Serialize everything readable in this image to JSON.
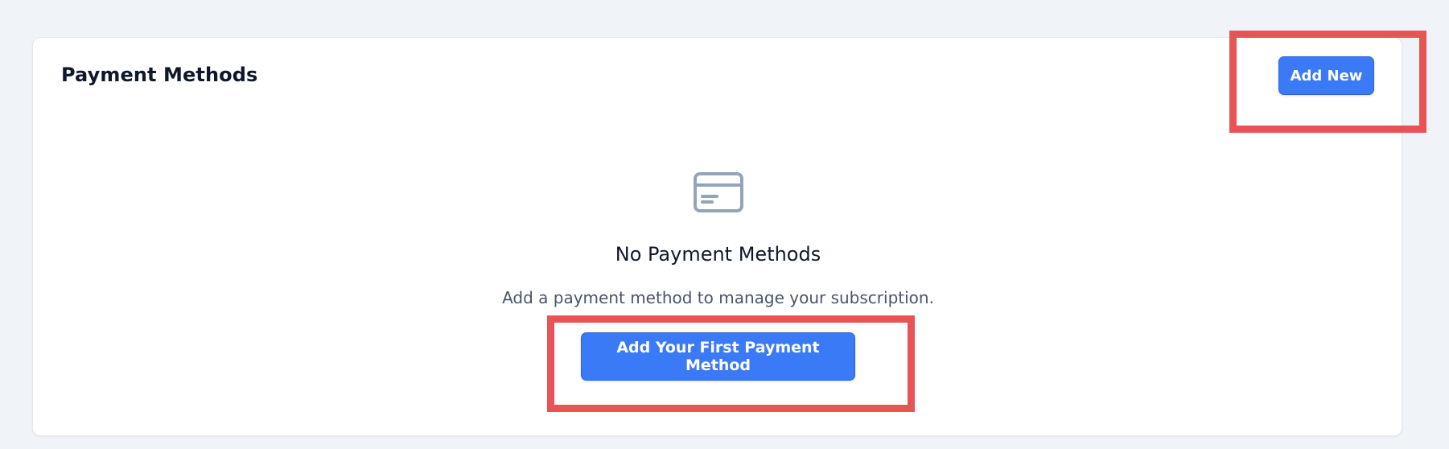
{
  "card": {
    "title": "Payment Methods",
    "add_new_label": "Add New"
  },
  "empty_state": {
    "icon": "credit-card-icon",
    "title": "No Payment Methods",
    "description": "Add a payment method to manage your subscription.",
    "cta_label": "Add Your First Payment Method"
  },
  "colors": {
    "page_bg": "#f0f3f8",
    "accent": "#3b7af7",
    "highlight": "#e85456",
    "icon": "#94a3b8"
  }
}
